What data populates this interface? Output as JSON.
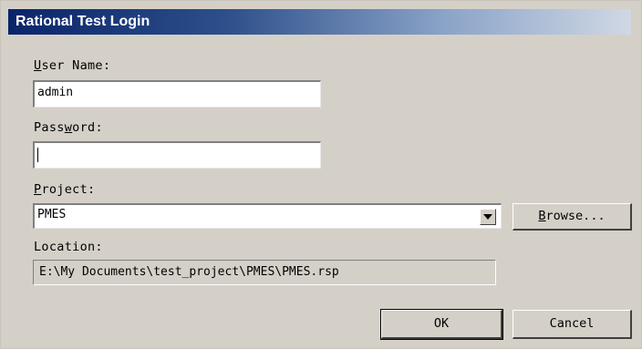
{
  "window": {
    "title": "Rational Test Login"
  },
  "form": {
    "username": {
      "label_mnemonic": "U",
      "label_rest": "ser Name:",
      "value": "admin"
    },
    "password": {
      "label_pre": "Pass",
      "label_mnemonic": "w",
      "label_post": "ord:",
      "value": ""
    },
    "project": {
      "label_mnemonic": "P",
      "label_rest": "roject:",
      "selected": "PMES",
      "browse_mnemonic": "B",
      "browse_rest": "rowse..."
    },
    "location": {
      "label": "Location:",
      "value": "E:\\My Documents\\test_project\\PMES\\PMES.rsp"
    }
  },
  "buttons": {
    "ok": "OK",
    "cancel": "Cancel"
  }
}
